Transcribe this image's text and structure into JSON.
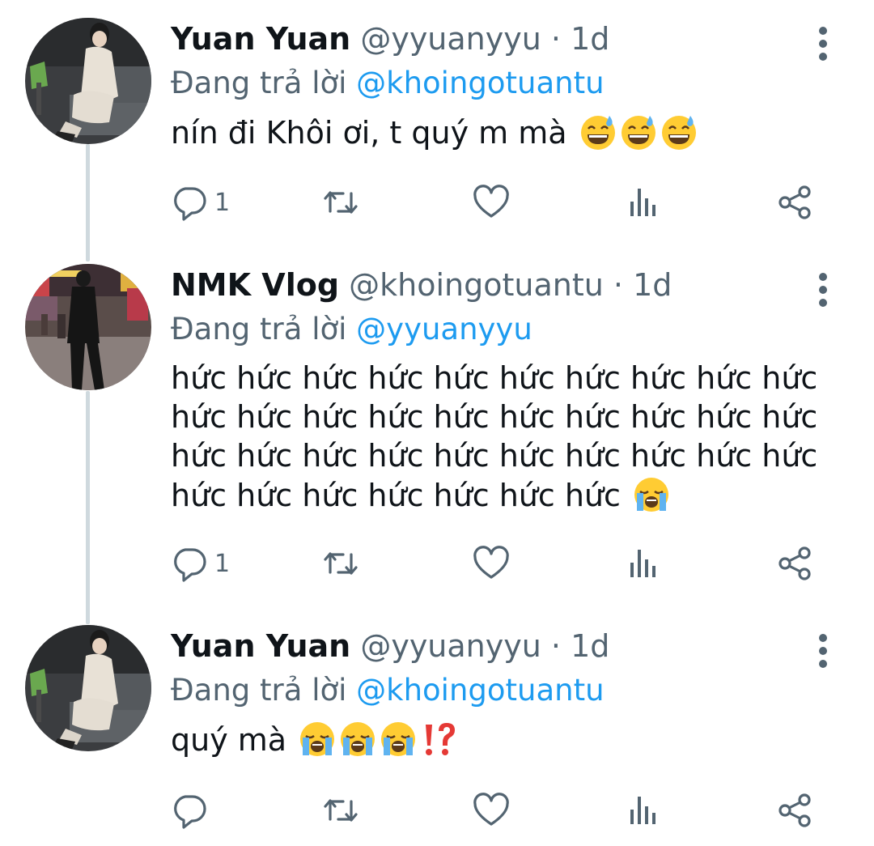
{
  "thread": {
    "tweets": [
      {
        "display_name": "Yuan Yuan",
        "handle": "@yyuanyyu",
        "separator": "·",
        "time": "1d",
        "replying_prefix": "Đang trả lời",
        "replying_to": "@khoingotuantu",
        "text": "nín đi Khôi ơi, t quý m mà",
        "emojis": [
          "grinning-sweat-emoji",
          "grinning-sweat-emoji",
          "grinning-sweat-emoji"
        ],
        "reply_count": "1"
      },
      {
        "display_name": "NMK Vlog",
        "handle": "@khoingotuantu",
        "separator": "·",
        "time": "1d",
        "replying_prefix": "Đang trả lời",
        "replying_to": "@yyuanyyu",
        "text": "hức hức hức hức hức hức hức hức hức hức\nhức hức hức hức hức hức hức hức hức hức\nhức hức hức hức hức hức hức hức hức hức\nhức hức hức hức hức hức hức",
        "emojis": [
          "loudly-crying-emoji"
        ],
        "reply_count": "1"
      },
      {
        "display_name": "Yuan Yuan",
        "handle": "@yyuanyyu",
        "separator": "·",
        "time": "1d",
        "replying_prefix": "Đang trả lời",
        "replying_to": "@khoingotuantu",
        "text": "quý mà",
        "emojis": [
          "loudly-crying-emoji",
          "loudly-crying-emoji",
          "loudly-crying-emoji",
          "exclamation-question-emoji"
        ],
        "reply_count": ""
      }
    ]
  },
  "icons": {
    "reply": "reply-icon",
    "retweet": "retweet-icon",
    "like": "heart-icon",
    "views": "views-icon",
    "share": "share-icon",
    "more": "more-vertical-icon"
  },
  "colors": {
    "text": "#0f1419",
    "secondary": "#536471",
    "mention": "#1d9bf0",
    "thread_line": "#cfd9de"
  }
}
